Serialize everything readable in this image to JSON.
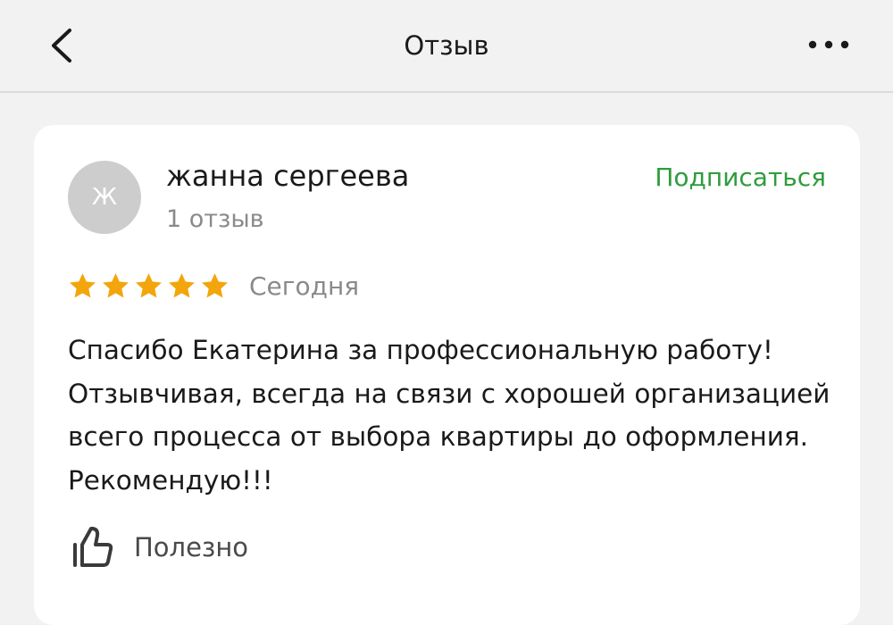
{
  "header": {
    "title": "Отзыв",
    "back_icon": "chevron-left-icon",
    "more_icon": "more-horizontal-icon"
  },
  "review": {
    "author": {
      "avatar_letter": "Ж",
      "name": "жанна сергеева",
      "reviews_count": "1 отзыв"
    },
    "subscribe_label": "Подписаться",
    "rating": 5,
    "rating_max": 5,
    "date": "Сегодня",
    "text": "Спасибо Екатерина за профессиональную работу! Отзывчивая, всегда на связи с хорошей организацией всего процесса от выбора квартиры до оформления. Рекомендую!!!",
    "useful_label": "Полезно",
    "useful_icon": "thumbs-up-icon"
  },
  "colors": {
    "accent_green": "#2f9c3c",
    "star_gold": "#f2a60c",
    "avatar_bg": "#cdcdcd",
    "page_bg": "#f2f2f2",
    "card_bg": "#ffffff"
  }
}
